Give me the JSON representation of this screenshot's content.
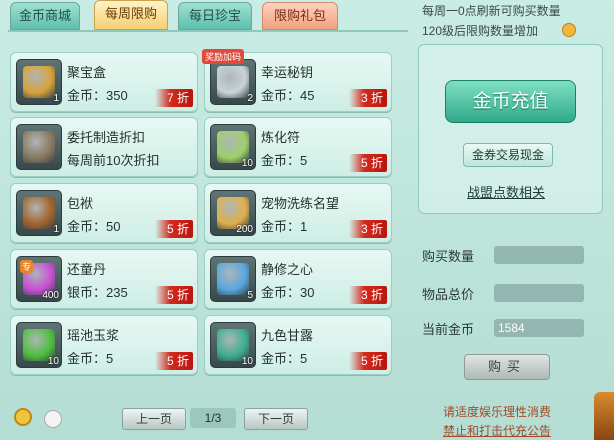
{
  "tabs": [
    {
      "label": "金币商城",
      "style": "teal"
    },
    {
      "label": "每周限购",
      "style": "active"
    },
    {
      "label": "每日珍宝",
      "style": "teal"
    },
    {
      "label": "限购礼包",
      "style": "pink"
    }
  ],
  "items": [
    {
      "name": "聚宝盒",
      "price": "金币：350",
      "discount": "7 折",
      "count": "1",
      "tag": "",
      "color": "#d9a23a"
    },
    {
      "name": "幸运秘钥",
      "price": "金币：45",
      "discount": "3 折",
      "count": "2",
      "tag": "奖励加码",
      "color": "#c9d3d8"
    },
    {
      "name": "委托制造折扣",
      "price": "每周前10次折扣",
      "discount": "",
      "count": "",
      "tag": "",
      "color": "#8a7a60"
    },
    {
      "name": "炼化符",
      "price": "金币：5",
      "discount": "5 折",
      "count": "10",
      "tag": "",
      "color": "#9fd06a"
    },
    {
      "name": "包袱",
      "price": "金币：50",
      "discount": "5 折",
      "count": "1",
      "tag": "",
      "color": "#a5642c"
    },
    {
      "name": "宠物洗练名望",
      "price": "金币：1",
      "discount": "3 折",
      "count": "200",
      "tag": "",
      "color": "#e0b04a"
    },
    {
      "name": "还童丹",
      "price": "银币：235",
      "discount": "5 折",
      "count": "400",
      "tag": "专",
      "color": "#c94fd6"
    },
    {
      "name": "静修之心",
      "price": "金币：30",
      "discount": "3 折",
      "count": "5",
      "tag": "",
      "color": "#5aa7e0"
    },
    {
      "name": "瑶池玉浆",
      "price": "金币：5",
      "discount": "5 折",
      "count": "10",
      "tag": "",
      "color": "#4fbf3f"
    },
    {
      "name": "九色甘露",
      "price": "金币：5",
      "discount": "5 折",
      "count": "10",
      "tag": "",
      "color": "#3fae8f"
    }
  ],
  "info": {
    "line1": "每周一0点刷新可购买数量",
    "line2": "120级后限购数量增加"
  },
  "panel": {
    "recharge": "金币充值",
    "voucher": "金券交易现金",
    "points": "战盟点数相关"
  },
  "form": {
    "qty_label": "购买数量",
    "qty_value": "",
    "total_label": "物品总价",
    "total_value": "",
    "gold_label": "当前金币",
    "gold_value": "1584",
    "buy": "购买"
  },
  "notice": {
    "line1": "请适度娱乐理性消费",
    "line2": "禁止和打击代充公告"
  },
  "pager": {
    "prev": "上一页",
    "page": "1/3",
    "next": "下一页"
  }
}
